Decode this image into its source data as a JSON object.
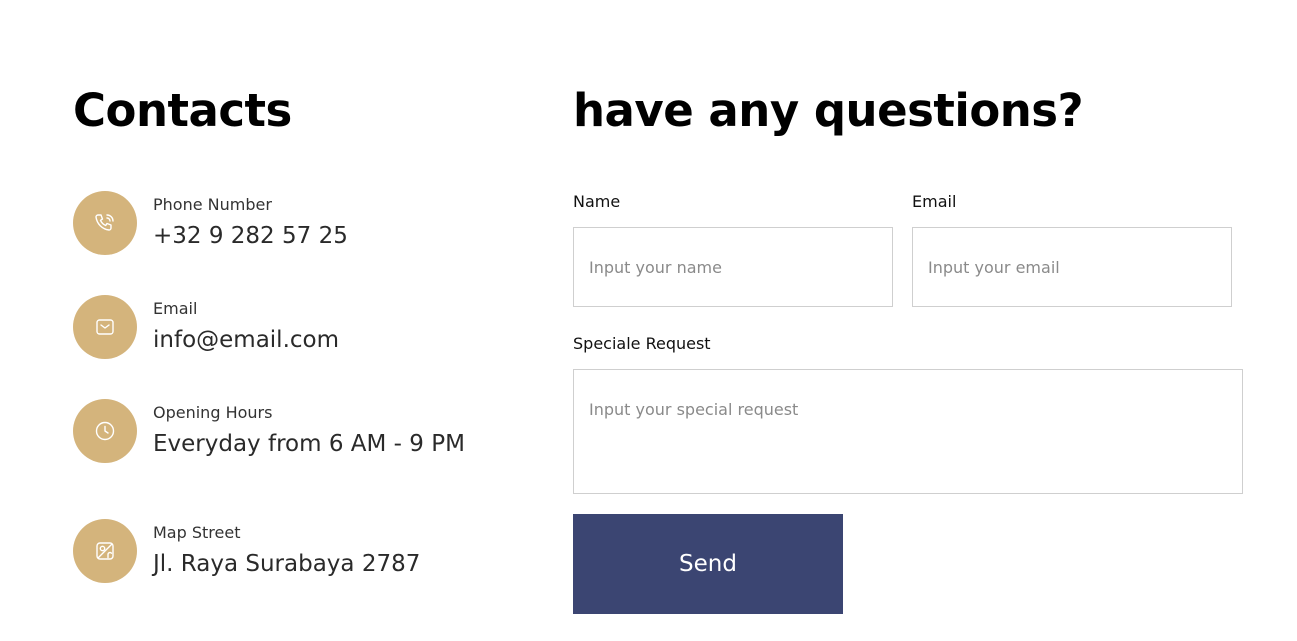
{
  "contacts": {
    "title": "Contacts",
    "accent_color": "#d4b47c",
    "items": [
      {
        "icon": "phone-icon",
        "label": "Phone Number",
        "value": "+32 9 282 57 25"
      },
      {
        "icon": "mail-icon",
        "label": "Email",
        "value": "info@email.com"
      },
      {
        "icon": "clock-icon",
        "label": "Opening Hours",
        "value": "Everyday from 6 AM - 9 PM"
      },
      {
        "icon": "map-icon",
        "label": "Map Street",
        "value": "Jl. Raya Surabaya 2787"
      }
    ]
  },
  "form": {
    "title": "have any questions?",
    "name": {
      "label": "Name",
      "placeholder": "Input your name"
    },
    "email": {
      "label": "Email",
      "placeholder": "Input your email"
    },
    "request": {
      "label": "Speciale Request",
      "placeholder": "Input your special request"
    },
    "send_label": "Send",
    "button_color": "#3b4572"
  }
}
